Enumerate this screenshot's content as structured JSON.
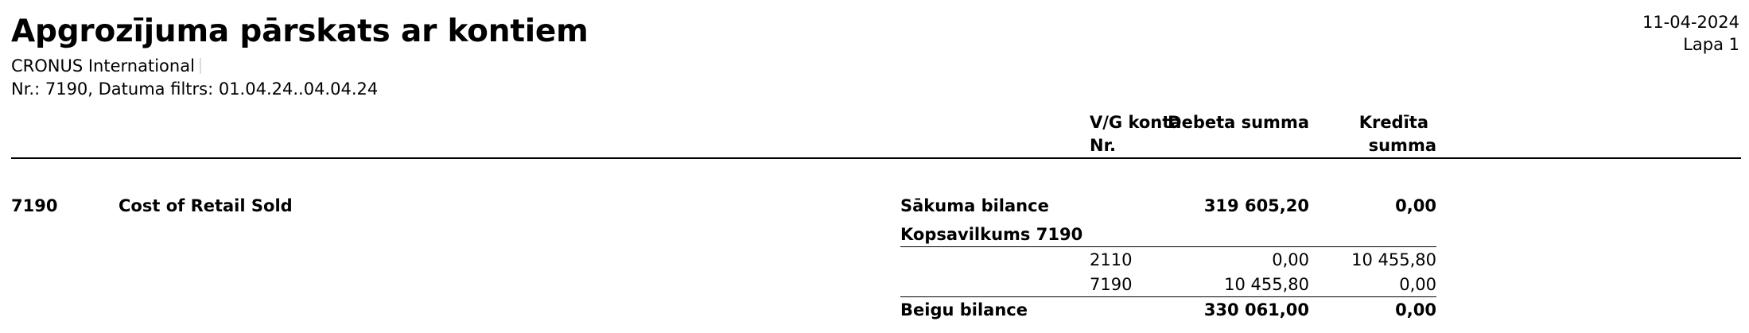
{
  "report": {
    "title": "Apgrozījuma pārskats ar kontiem",
    "company": "CRONUS International",
    "filter": "Nr.: 7190, Datuma filtrs: 01.04.24..04.04.24",
    "date": "11-04-2024",
    "page": "Lapa 1"
  },
  "columns": {
    "gl_account_line1": "V/G konta",
    "gl_account_line2": "Nr.",
    "debit": "Debeta summa",
    "credit_line1": "Kredīta",
    "credit_line2": "summa"
  },
  "account": {
    "no": "7190",
    "name": "Cost of Retail Sold",
    "opening_label": "Sākuma bilance",
    "opening_debit": "319 605,20",
    "opening_credit": "0,00",
    "summary_label": "Kopsavilkums 7190",
    "entries": [
      {
        "gl_account": "2110",
        "debit": "0,00",
        "credit": "10 455,80"
      },
      {
        "gl_account": "7190",
        "debit": "10 455,80",
        "credit": "0,00"
      }
    ],
    "closing_label": "Beigu bilance",
    "closing_debit": "330 061,00",
    "closing_credit": "0,00"
  }
}
